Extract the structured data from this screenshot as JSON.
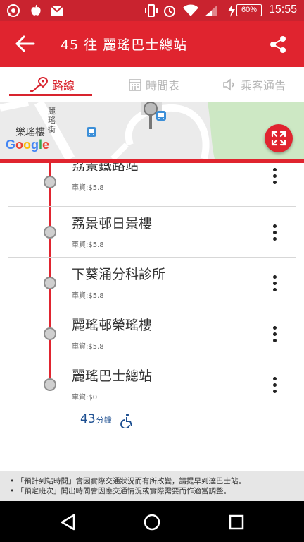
{
  "status_bar": {
    "time": "15:55",
    "battery_percent": "60%",
    "icons": [
      "whatsapp-icon",
      "apple-icon",
      "gmail-icon",
      "vibrate-icon",
      "alarm-icon",
      "wifi-icon",
      "signal-icon",
      "charging-icon"
    ]
  },
  "app_bar": {
    "title": "45 往 麗瑤巴士總站",
    "icons": [
      "back-arrow-icon",
      "share-icon"
    ]
  },
  "tabs": [
    {
      "label": "路線",
      "icon": "route-pin-icon",
      "active": true
    },
    {
      "label": "時間表",
      "icon": "calendar-icon",
      "active": false
    },
    {
      "label": "乘客通告",
      "icon": "speaker-icon",
      "active": false
    }
  ],
  "map": {
    "place_label": "樂瑤樓",
    "street_label": "麗瑤街",
    "logo_text": "Google",
    "expand_icon": "expand-arrows-icon"
  },
  "stops": [
    {
      "name": "荔景鐵路站",
      "fare": "車資:$5.8"
    },
    {
      "name": "荔景邨日景樓",
      "fare": "車資:$5.8"
    },
    {
      "name": "下葵涌分科診所",
      "fare": "車資:$5.8"
    },
    {
      "name": "麗瑤邨榮瑤樓",
      "fare": "車資:$5.8"
    },
    {
      "name": "麗瑤巴士總站",
      "fare": "車資:$0"
    }
  ],
  "eta": {
    "minutes": "43",
    "unit": "分鐘",
    "accessibility_icon": "wheelchair-icon"
  },
  "notes": [
    "• 「預計到站時間」會因實際交通狀況而有所改變，請提早到達巴士站。",
    "• 「預定班次」開出時間會因應交通情況或實際需要而作適當調整。"
  ],
  "nav_bar": {
    "icons": [
      "back-triangle-icon",
      "home-circle-icon",
      "recents-square-icon"
    ]
  },
  "colors": {
    "brand_red": "#e0242f",
    "status_red": "#c9232f",
    "eta_blue": "#1d4f91"
  }
}
